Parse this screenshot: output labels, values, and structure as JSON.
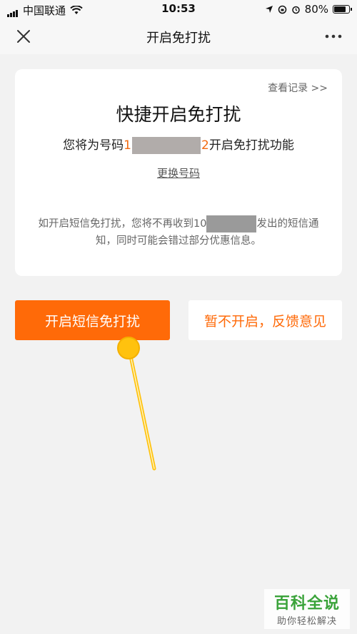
{
  "status_bar": {
    "carrier": "中国联通",
    "time": "10:53",
    "battery": "80%"
  },
  "nav": {
    "title": "开启免打扰",
    "close_icon": "close-icon",
    "more_icon": "more-dots-icon"
  },
  "card": {
    "history_link": "查看记录 >>",
    "heading": "快捷开启免打扰",
    "desc_prefix": "您将为号码",
    "phone_start": "1",
    "phone_end": "2",
    "desc_suffix": "开启免打扰功能",
    "change_number": "更换号码",
    "notice_part1": "如开启短信免打扰，您将不再收到10",
    "notice_part2": "发出的短信通知，同时可能会错过部分优惠信息。"
  },
  "actions": {
    "enable_label": "开启短信免打扰",
    "decline_label": "暂不开启，反馈意见"
  },
  "watermark": {
    "title": "百科全说",
    "subtitle": "助你轻松解决"
  },
  "colors": {
    "accent": "#ff6a08",
    "pointer": "#ffc20e"
  }
}
